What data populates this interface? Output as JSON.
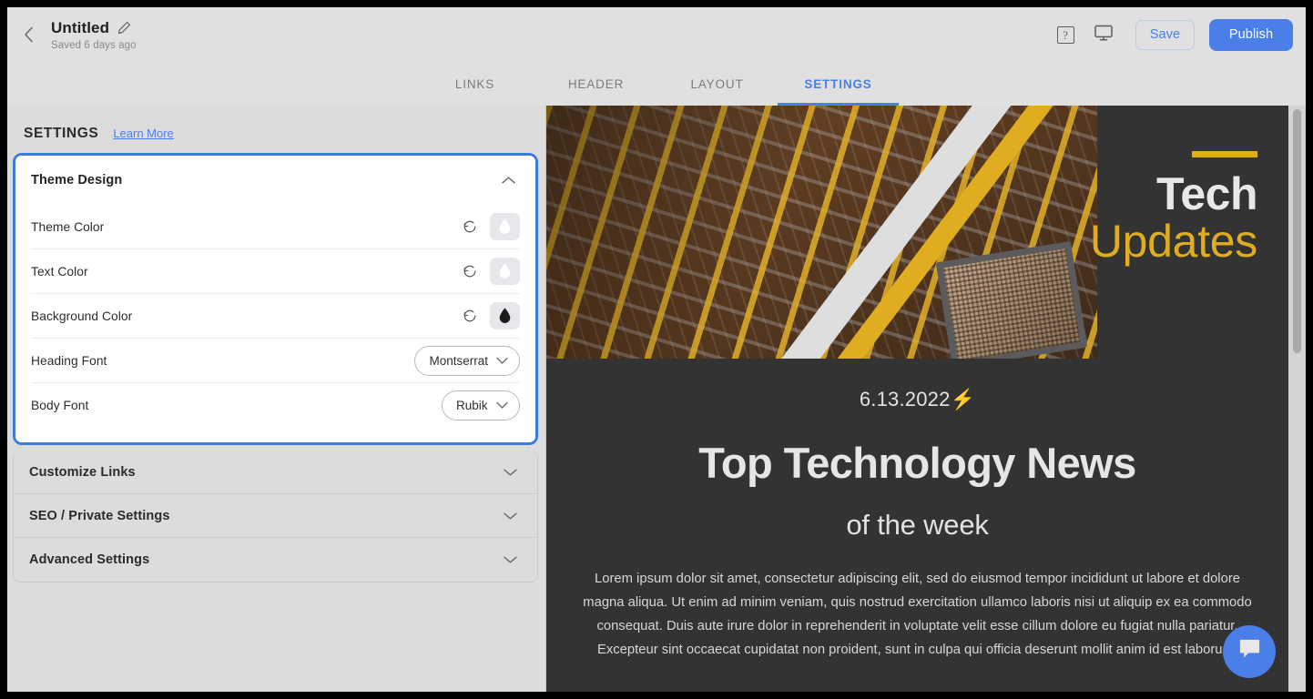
{
  "topbar": {
    "back_icon": "chevron-left-icon",
    "doc_title": "Untitled",
    "edit_icon": "pencil-icon",
    "saved_text": "Saved 6 days ago",
    "help_icon": "question-mark-icon",
    "help_glyph": "?",
    "preview_icon": "monitor-icon",
    "save_label": "Save",
    "publish_label": "Publish",
    "accent_color": "#4a7fe8"
  },
  "tabs": [
    {
      "label": "LINKS",
      "active": false
    },
    {
      "label": "HEADER",
      "active": false
    },
    {
      "label": "LAYOUT",
      "active": false
    },
    {
      "label": "SETTINGS",
      "active": true
    }
  ],
  "sidebar": {
    "section_label": "SETTINGS",
    "learn_more_label": "Learn More",
    "theme_design": {
      "title": "Theme Design",
      "chevron_icon": "chevron-up-icon",
      "rows": [
        {
          "label": "Theme Color",
          "control": "color-swatch",
          "reset_icon": "reset-icon",
          "swatch_color": "#ffffff"
        },
        {
          "label": "Text Color",
          "control": "color-swatch",
          "reset_icon": "reset-icon",
          "swatch_color": "#ffffff"
        },
        {
          "label": "Background Color",
          "control": "color-swatch",
          "reset_icon": "reset-icon",
          "swatch_color": "#1b1b1b"
        },
        {
          "label": "Heading Font",
          "control": "select",
          "value": "Montserrat",
          "chevron_icon": "chevron-down-icon"
        },
        {
          "label": "Body Font",
          "control": "select",
          "value": "Rubik",
          "chevron_icon": "chevron-down-icon"
        }
      ]
    },
    "collapsed_sections": [
      {
        "title": "Customize Links",
        "chevron_icon": "chevron-down-icon"
      },
      {
        "title": "SEO / Private Settings",
        "chevron_icon": "chevron-down-icon"
      },
      {
        "title": "Advanced Settings",
        "chevron_icon": "chevron-down-icon"
      }
    ]
  },
  "preview": {
    "background_color": "#333333",
    "accent_color": "#e0ad21",
    "banner": {
      "image_alt": "circuit-board-photo",
      "title_line1": "Tech",
      "title_line2": "Updates"
    },
    "date": "6.13.2022⚡",
    "heading": "Top Technology News",
    "subheading": "of the week",
    "paragraph": "Lorem ipsum dolor sit amet, consectetur adipiscing elit, sed do eiusmod tempor incididunt ut labore et dolore magna aliqua. Ut enim ad minim veniam, quis nostrud exercitation ullamco laboris nisi ut aliquip ex ea commodo consequat. Duis aute irure dolor in reprehenderit in voluptate velit esse cillum dolore eu fugiat nulla pariatur. Excepteur sint occaecat cupidatat non proident, sunt in culpa qui officia deserunt mollit anim id est laborum."
  },
  "chat_fab": {
    "icon": "chat-bubble-icon",
    "color": "#4a7fe8"
  }
}
